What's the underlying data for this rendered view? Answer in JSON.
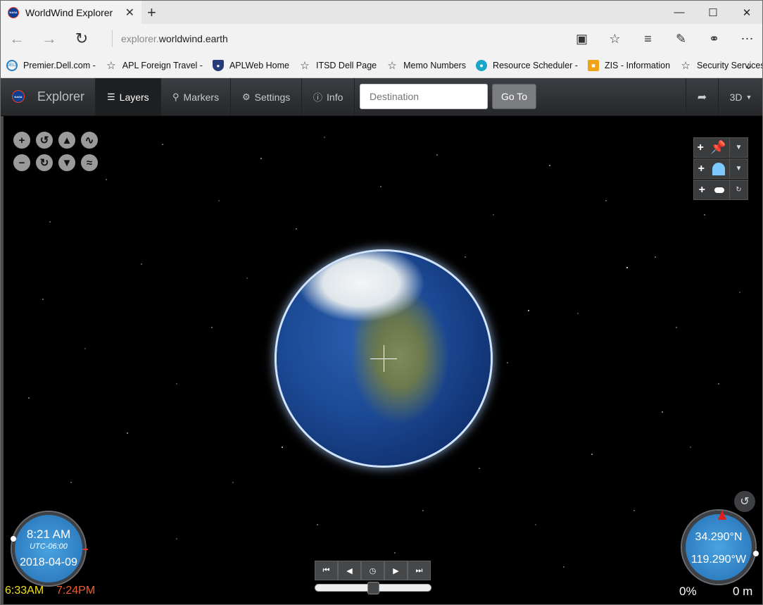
{
  "browser": {
    "tab_title": "WorldWind Explorer",
    "url_prefix": "explorer.",
    "url_host": "worldwind.earth"
  },
  "favorites": [
    {
      "label": "Premier.Dell.com -",
      "icon": "dell-icon"
    },
    {
      "label": "APL Foreign Travel -",
      "icon": "star-icon"
    },
    {
      "label": "APLWeb Home",
      "icon": "shield-icon"
    },
    {
      "label": "ITSD Dell Page",
      "icon": "star-icon"
    },
    {
      "label": "Memo Numbers",
      "icon": "star-icon"
    },
    {
      "label": "Resource Scheduler -",
      "icon": "resource-icon"
    },
    {
      "label": "ZIS - Information",
      "icon": "zis-icon"
    },
    {
      "label": "Security Services",
      "icon": "star-icon"
    }
  ],
  "app": {
    "brand": "Explorer",
    "nav": {
      "layers": "Layers",
      "markers": "Markers",
      "settings": "Settings",
      "info": "Info"
    },
    "destination_placeholder": "Destination",
    "goto_label": "Go To",
    "mode_label": "3D"
  },
  "time": {
    "clock": "8:21 AM",
    "zone": "UTC-06:00",
    "date": "2018-04-09",
    "sunrise": "6:33AM",
    "sunset": "7:24PM"
  },
  "compass": {
    "lat": "34.290°N",
    "lon": "119.290°W",
    "tilt": "0%",
    "altitude": "0 m"
  }
}
